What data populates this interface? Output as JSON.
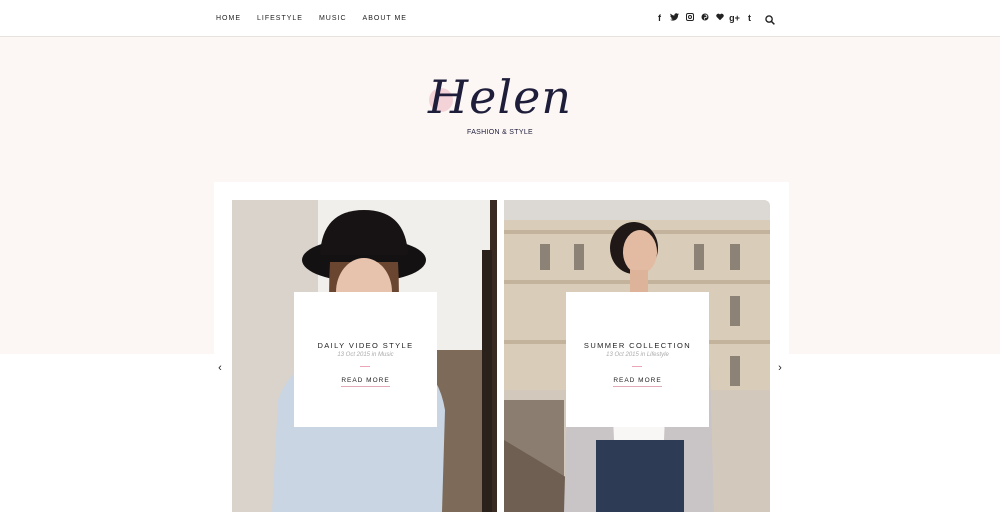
{
  "nav": {
    "menu": [
      "HOME",
      "LIFESTYLE",
      "MUSIC",
      "ABOUT ME"
    ],
    "social_icons": [
      "facebook-icon",
      "twitter-icon",
      "instagram-icon",
      "pinterest-icon",
      "heart-icon",
      "google-plus-icon",
      "tumblr-icon"
    ],
    "social_glyphs": [
      "f",
      "t",
      "",
      "p",
      "",
      "g+",
      "t"
    ]
  },
  "logo": {
    "name": "Helen",
    "tagline": "FASHION & STYLE"
  },
  "slides": [
    {
      "title": "DAILY VIDEO STYLE",
      "meta": "13 Oct 2015 in Music",
      "more": "READ MORE"
    },
    {
      "title": "SUMMER COLLECTION",
      "meta": "13 Oct 2015 in Lifestyle",
      "more": "READ MORE"
    }
  ],
  "arrows": {
    "prev": "‹",
    "next": "›"
  },
  "colors": {
    "hero_bg": "#fcf7f4",
    "accent_pink": "#e8a6b6",
    "logo_ink": "#1e1d3a"
  }
}
